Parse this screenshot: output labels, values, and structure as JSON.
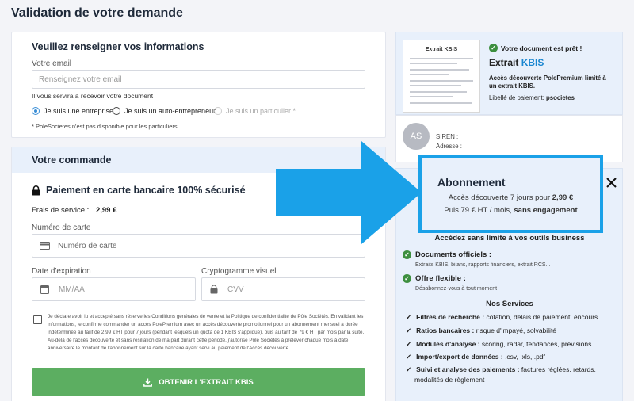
{
  "page": {
    "title": "Validation de votre demande"
  },
  "info": {
    "heading": "Veuillez renseigner vos informations",
    "email_label": "Votre email",
    "email_placeholder": "Renseignez votre email",
    "email_help": "Il vous servira à recevoir votre document",
    "radios": [
      {
        "label": "Je suis une entreprise",
        "state": "selected"
      },
      {
        "label": "Je suis un auto-entrepreneur",
        "state": "unselected"
      },
      {
        "label": "Je suis un particulier *",
        "state": "disabled"
      }
    ],
    "note": "* PoleSocietes n'est pas disponible pour les particuliers."
  },
  "order": {
    "heading": "Votre commande",
    "secure_title": "Paiement en carte bancaire 100% sécurisé",
    "fees_label": "Frais de service :",
    "fees_value": "2,99 €",
    "card_number_label": "Numéro de carte",
    "card_number_placeholder": "Numéro de carte",
    "expiry_label": "Date d'expiration",
    "expiry_placeholder": "MM/AA",
    "cvv_label": "Cryptogramme visuel",
    "cvv_placeholder": "CVV",
    "legal_p1": "Je déclare avoir lu et accepté sans réserve les ",
    "legal_link1": "Conditions générales de vente",
    "legal_p2": " et la ",
    "legal_link2": "Politique de confidentialité",
    "legal_p3": " de Pôle Sociétés. En validant les informations, je confirme commander un accès PolePremium avec un accès découverte promotionnel pour un abonnement mensuel à durée indéterminée au tarif de 2,99 € HT pour 7 jours (pendant lesquels un quota de 1 KBIS s'applique), puis au tarif de 79 € HT par mois par la suite. Au-delà de l'accès découverte et sans résiliation de ma part durant cette période, j'autorise Pôle Sociétés à prélever chaque mois à date anniversaire le montant de l'abonnement sur la carte bancaire ayant servi au paiement de l'Accès découverte.",
    "cta_label": "OBTENIR L'EXTRAIT KBIS"
  },
  "sidebar": {
    "ready_label": "Votre document est prêt !",
    "doc_title_prefix": "Extrait ",
    "doc_title_highlight": "KBIS",
    "doc_thumb_title": "Extrait KBIS",
    "offer_text": "Accès découverte PolePremium limité à un extrait KBIS.",
    "payment_label": "Libellé de paiement:",
    "payment_value": "psocietes",
    "avatar_initials": "AS",
    "siren_label": "SIREN :",
    "address_label": "Adresse :",
    "subscription": {
      "title": "Abonnement",
      "line1_prefix": "Accès découverte 7 jours pour ",
      "line1_price": "2,99 €",
      "line2_prefix": "Puis 79 € HT / mois, ",
      "line2_bold": "sans engagement"
    },
    "access_heading": "Accédez sans limite à vos outils business",
    "features": [
      {
        "title": "Documents officiels :",
        "desc": "Extraits KBIS, bilans, rapports financiers, extrait RCS..."
      },
      {
        "title": "Offre flexible :",
        "desc": "Désabonnez-vous à tout moment"
      }
    ],
    "services_heading": "Nos Services",
    "services": [
      {
        "bold": "Filtres de recherche :",
        "text": " cotation, délais de paiement, encours..."
      },
      {
        "bold": "Ratios bancaires :",
        "text": " risque d'impayé, solvabilité"
      },
      {
        "bold": "Modules d'analyse :",
        "text": " scoring, radar, tendances, prévisions"
      },
      {
        "bold": "Import/export de données :",
        "text": " .csv, .xls, .pdf"
      },
      {
        "bold": "Suivi et analyse des paiements :",
        "text": " factures réglées, retards,"
      },
      {
        "bold": "",
        "text": "modalités de règlement"
      }
    ]
  },
  "colors": {
    "accent_blue": "#1aa1e8",
    "cta_green": "#5cae61",
    "check_green": "#3d8f3f"
  }
}
